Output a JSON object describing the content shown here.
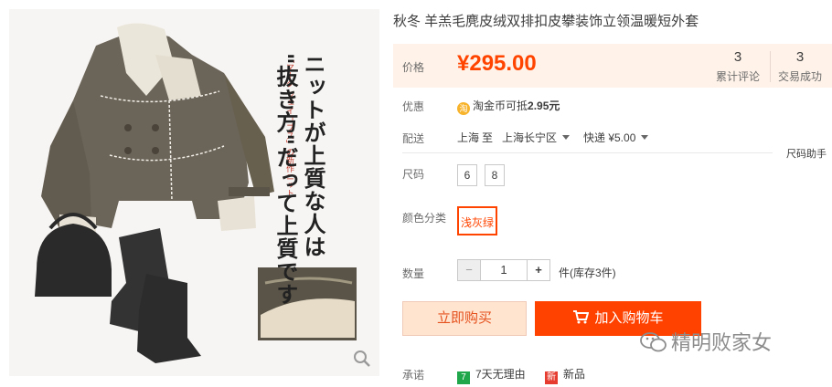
{
  "product": {
    "title": "秋冬 羊羔毛麂皮绒双排扣皮攀装饰立领温暖短外套",
    "price_label": "价格",
    "price": "¥295.00",
    "stats": [
      {
        "num": "3",
        "label": "累计评论"
      },
      {
        "num": "3",
        "label": "交易成功"
      }
    ]
  },
  "promo": {
    "label": "优惠",
    "coin_glyph": "淘",
    "text_prefix": "淘金币可抵",
    "amount": "2.95元"
  },
  "delivery": {
    "label": "配送",
    "from": "上海",
    "to_word": "至",
    "to": "上海长宁区",
    "method": "快递 ¥5.00"
  },
  "size": {
    "label": "尺码",
    "options": [
      "6",
      "8"
    ],
    "helper": "尺码助手"
  },
  "color": {
    "label": "颜色分类",
    "selected": "浅灰绿"
  },
  "quantity": {
    "label": "数量",
    "value": "1",
    "minus": "−",
    "plus": "+",
    "stock": "件(库存3件)"
  },
  "actions": {
    "buy": "立即购买",
    "cart": "加入购物车"
  },
  "promise": {
    "label": "承诺",
    "items": [
      {
        "glyph": "7",
        "text": "7天无理由",
        "color": "#20a64b"
      },
      {
        "glyph": "新",
        "text": "新品",
        "color": "#e63c2f"
      }
    ]
  },
  "image_text": {
    "line1": "ニットが上質な人は",
    "line2": "\"抜き方\"だって上質です",
    "small": "「マーク ジェイコブス」の新作ニット"
  },
  "watermark": "精明败家女",
  "colors": {
    "accent": "#ff4400",
    "price_bg": "#fff2e8"
  }
}
